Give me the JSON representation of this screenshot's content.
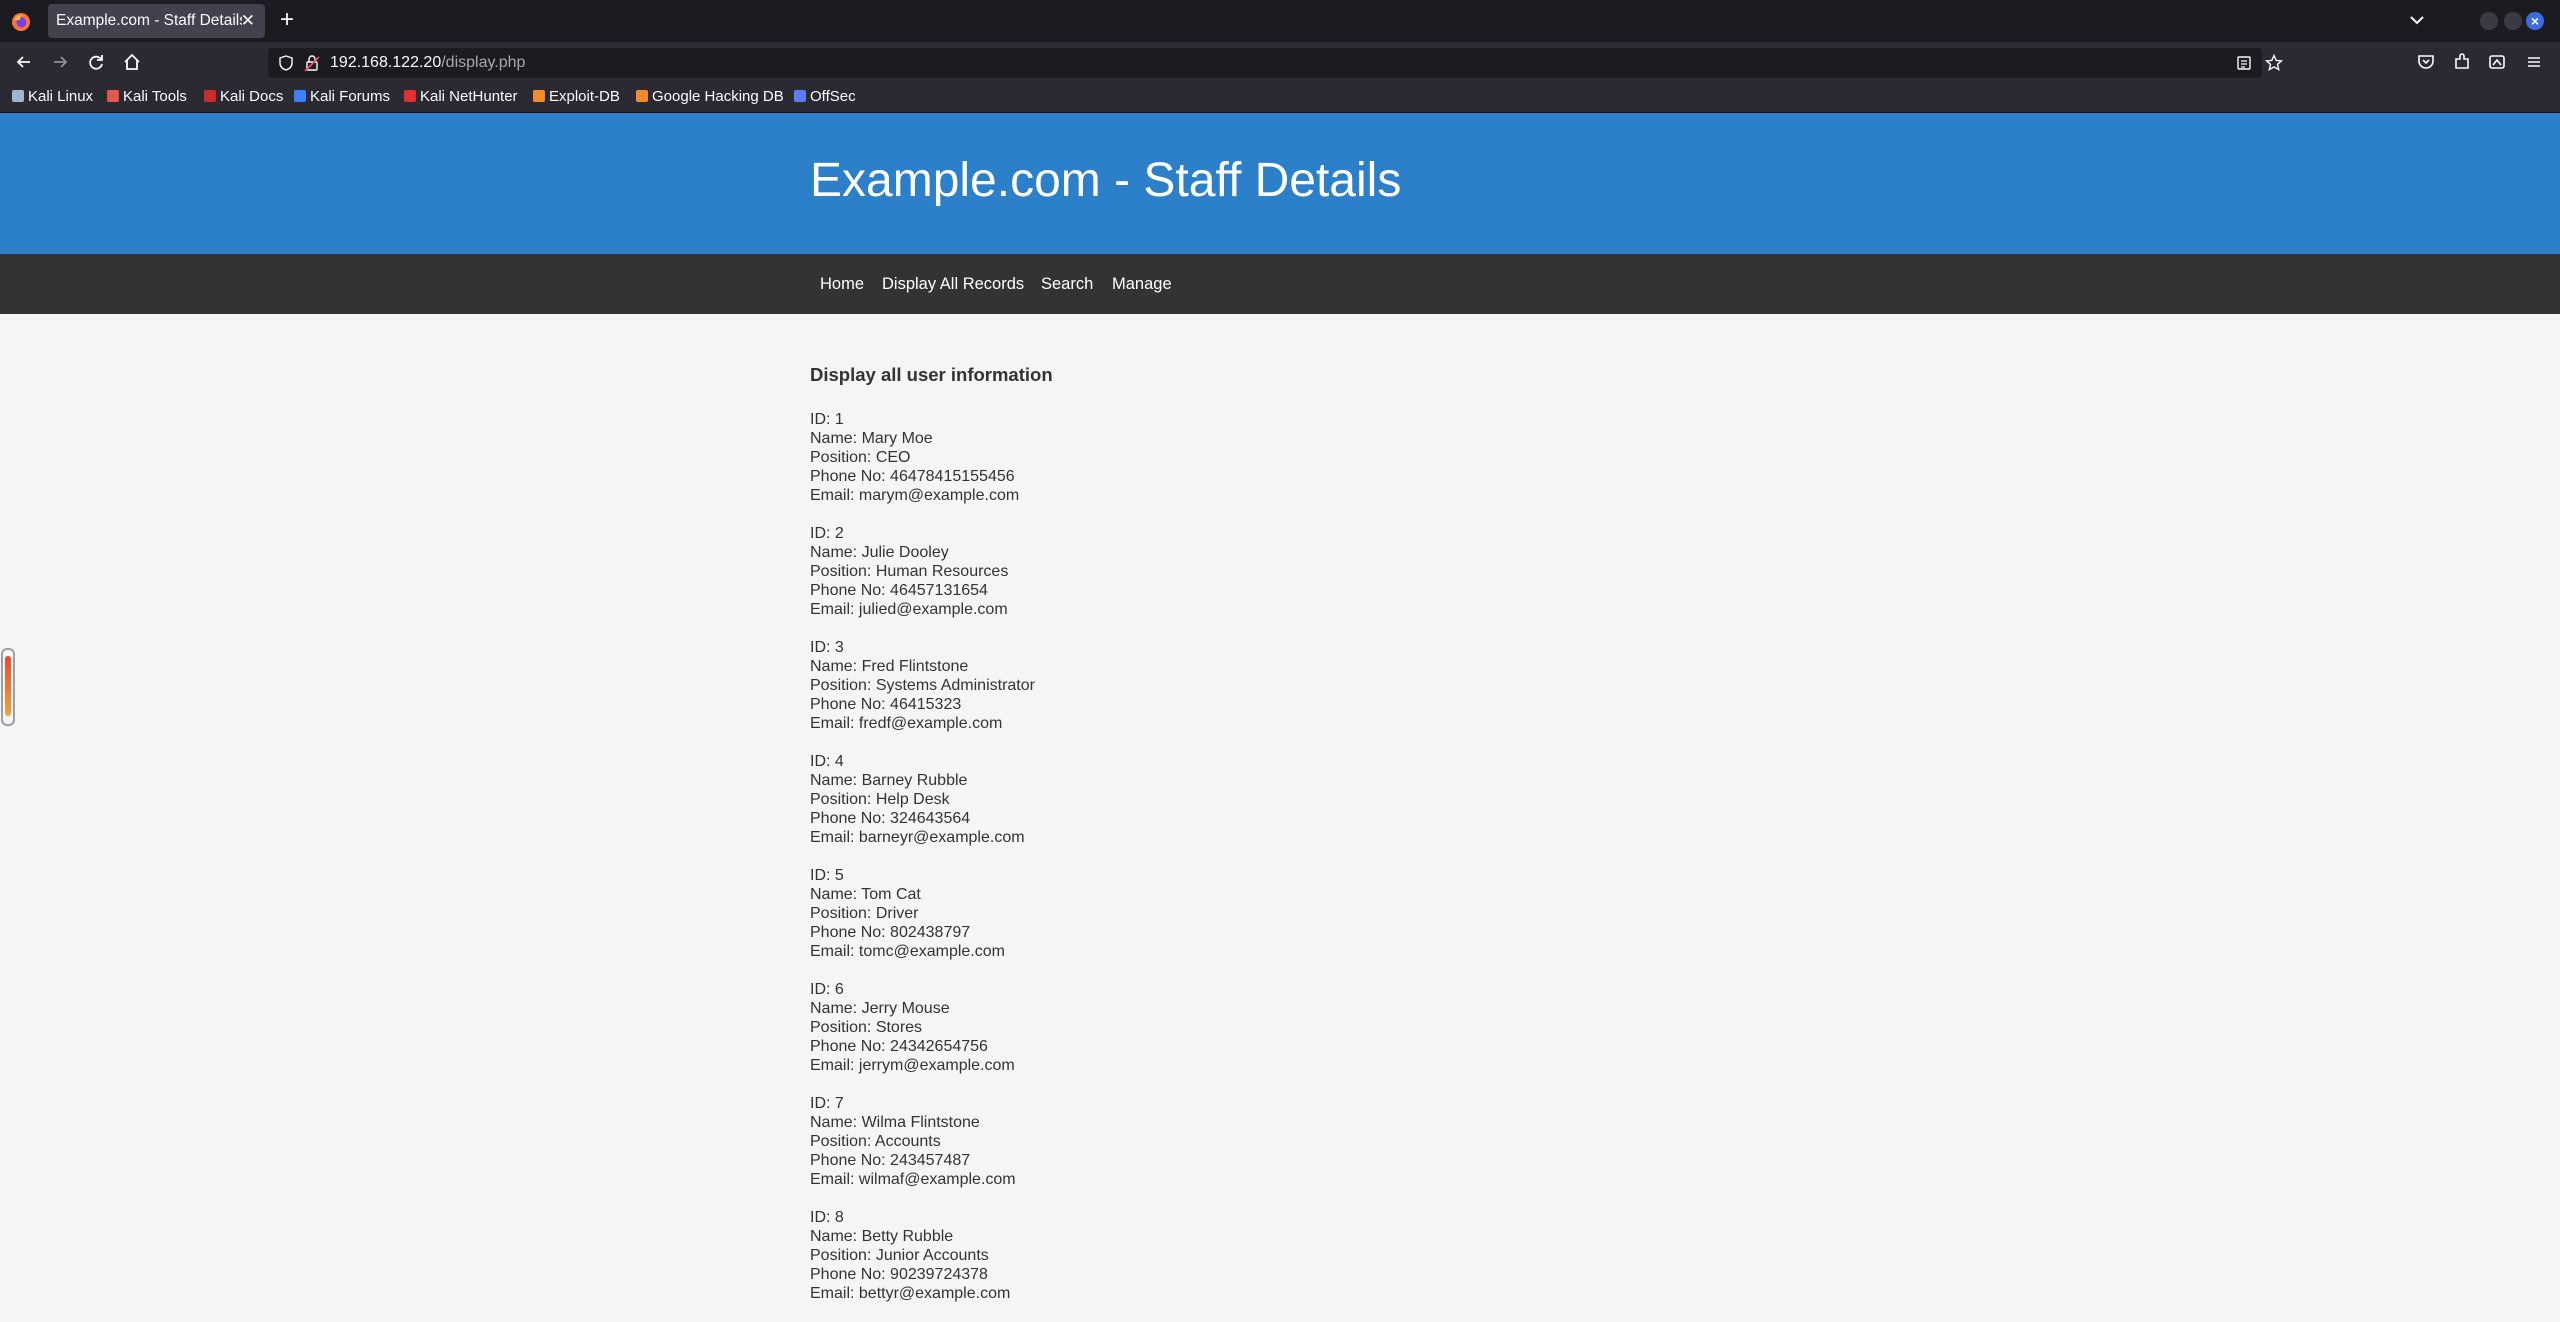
{
  "browser": {
    "tab_title": "Example.com - Staff Details",
    "tab_close": "✕",
    "new_tab": "+",
    "url_host": "192.168.122.20",
    "url_path": "/display.php",
    "bookmarks": [
      {
        "label": "Kali Linux",
        "icon_color": "#9fb6d0"
      },
      {
        "label": "Kali Tools",
        "icon_color": "#e05a4a"
      },
      {
        "label": "Kali Docs",
        "icon_color": "#c92a2a"
      },
      {
        "label": "Kali Forums",
        "icon_color": "#3b82f6"
      },
      {
        "label": "Kali NetHunter",
        "icon_color": "#e03131"
      },
      {
        "label": "Exploit-DB",
        "icon_color": "#f08c2e"
      },
      {
        "label": "Google Hacking DB",
        "icon_color": "#f08c2e"
      },
      {
        "label": "OffSec",
        "icon_color": "#5c7cfa"
      }
    ]
  },
  "site": {
    "title": "Example.com - Staff Details",
    "nav": [
      "Home",
      "Display All Records",
      "Search",
      "Manage"
    ],
    "heading": "Display all user information",
    "header_color": "#2c7fc9",
    "nav_color": "#333333"
  },
  "records": [
    {
      "id": "ID: 1",
      "name": "Name: Mary Moe",
      "position": "Position: CEO",
      "phone": "Phone No: 46478415155456",
      "email": "Email: marym@example.com"
    },
    {
      "id": "ID: 2",
      "name": "Name: Julie Dooley",
      "position": "Position: Human Resources",
      "phone": "Phone No: 46457131654",
      "email": "Email: julied@example.com"
    },
    {
      "id": "ID: 3",
      "name": "Name: Fred Flintstone",
      "position": "Position: Systems Administrator",
      "phone": "Phone No: 46415323",
      "email": "Email: fredf@example.com"
    },
    {
      "id": "ID: 4",
      "name": "Name: Barney Rubble",
      "position": "Position: Help Desk",
      "phone": "Phone No: 324643564",
      "email": "Email: barneyr@example.com"
    },
    {
      "id": "ID: 5",
      "name": "Name: Tom Cat",
      "position": "Position: Driver",
      "phone": "Phone No: 802438797",
      "email": "Email: tomc@example.com"
    },
    {
      "id": "ID: 6",
      "name": "Name: Jerry Mouse",
      "position": "Position: Stores",
      "phone": "Phone No: 24342654756",
      "email": "Email: jerrym@example.com"
    },
    {
      "id": "ID: 7",
      "name": "Name: Wilma Flintstone",
      "position": "Position: Accounts",
      "phone": "Phone No: 243457487",
      "email": "Email: wilmaf@example.com"
    },
    {
      "id": "ID: 8",
      "name": "Name: Betty Rubble",
      "position": "Position: Junior Accounts",
      "phone": "Phone No: 90239724378",
      "email": "Email: bettyr@example.com"
    }
  ]
}
